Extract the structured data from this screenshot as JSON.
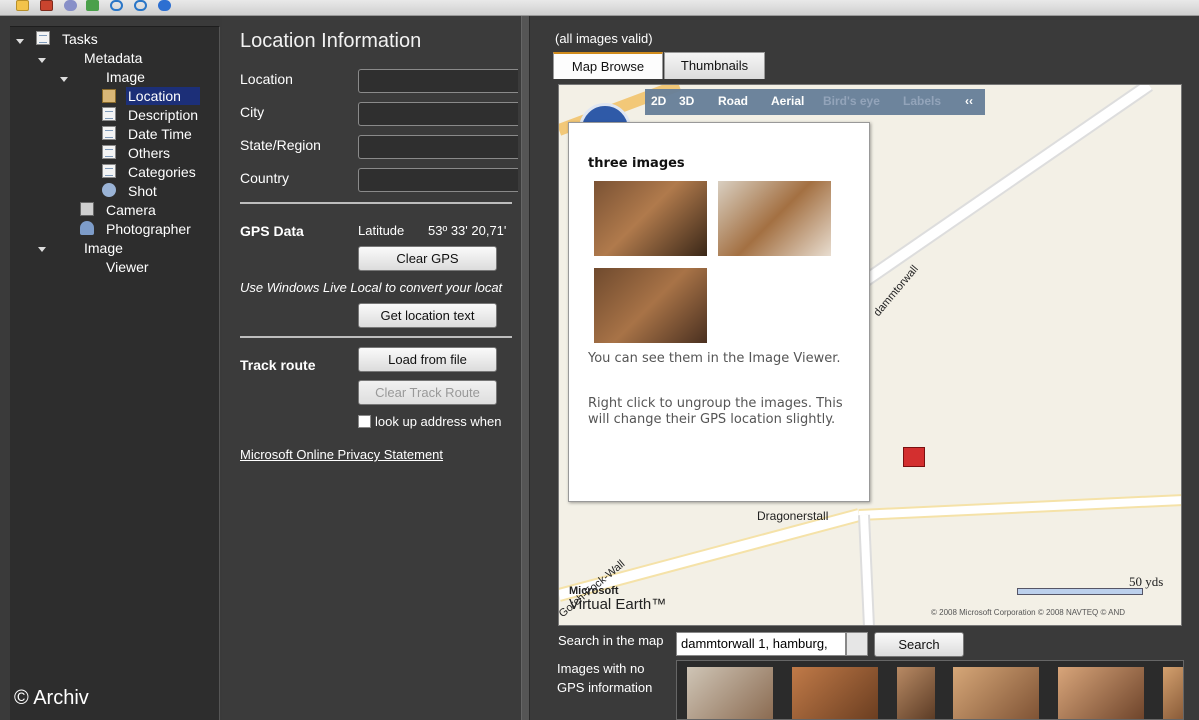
{
  "toolbar": {
    "icons": [
      "folder-icon",
      "close-icon",
      "palette-icon",
      "plugin-icon",
      "undo-icon",
      "redo-icon",
      "help-icon"
    ]
  },
  "tree": {
    "tasks": "Tasks",
    "metadata": "Metadata",
    "image": "Image",
    "items": [
      "Location",
      "Description",
      "Date Time",
      "Others",
      "Categories",
      "Shot"
    ],
    "camera": "Camera",
    "photographer": "Photographer",
    "image2": "Image",
    "viewer": "Viewer"
  },
  "form": {
    "title": "Location Information",
    "location_label": "Location",
    "city_label": "City",
    "state_label": "State/Region",
    "country_label": "Country",
    "gps_label": "GPS Data",
    "latitude_label": "Latitude",
    "latitude_value": "53º 33' 20,71'",
    "clear_gps": "Clear GPS",
    "convert_text": "Use Windows Live Local to convert your locat",
    "get_location": "Get location text",
    "track_label": "Track route",
    "load_file": "Load from file",
    "clear_track": "Clear Track Route",
    "lookup_label": "look up address when",
    "privacy": "Microsoft Online Privacy Statement"
  },
  "map": {
    "status": "(all images valid)",
    "tabs": [
      "Map Browse",
      "Thumbnails"
    ],
    "modes": [
      "2D",
      "3D",
      "Road",
      "Aerial",
      "Bird's eye",
      "Labels",
      "‹‹"
    ],
    "popup_title": "three images",
    "popup_text1": "You can see them in the Image Viewer.",
    "popup_text2": "Right click to ungroup the images. This will change their GPS location slightly.",
    "street1": "Dragonerstall",
    "street2": "dammtorwall",
    "street3": "Gorch-Fock-Wall",
    "logo_top": "Microsoft",
    "logo_bottom": "Virtual Earth™",
    "scale": "50 yds",
    "copyright": "© 2008 Microsoft Corporation   © 2008 NAVTEQ   © AND"
  },
  "search": {
    "label": "Search in the map",
    "value": "dammtorwall 1, hamburg,",
    "button": "Search",
    "nogps_line1": "Images with no",
    "nogps_line2": "GPS information"
  },
  "watermark": "© Archiv"
}
